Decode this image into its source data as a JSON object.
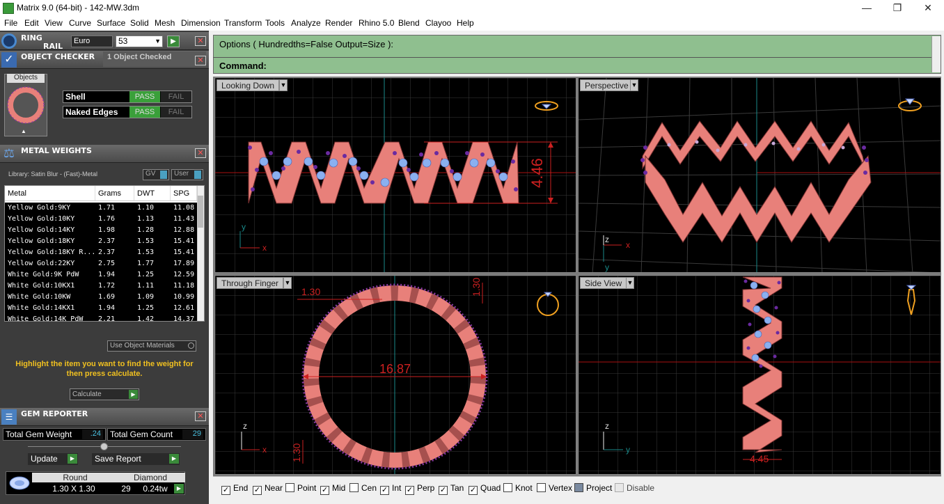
{
  "window": {
    "title": "Matrix 9.0 (64-bit) - 142-MW.3dm",
    "minimize": "—",
    "maximize": "❐",
    "close": "✕"
  },
  "menu": [
    "File",
    "Edit",
    "View",
    "Curve",
    "Surface",
    "Solid",
    "Mesh",
    "Dimension",
    "Transform",
    "Tools",
    "Analyze",
    "Render",
    "Rhino 5.0",
    "Blend",
    "Clayoo",
    "Help"
  ],
  "ring_rail": {
    "title_line1": "RING",
    "title_line2": "RAIL",
    "size_system": "Euro",
    "size": "53",
    "go": "▶"
  },
  "object_checker": {
    "title": "OBJECT CHECKER",
    "status": "1  Object Checked",
    "objects_label": "Objects",
    "checks": [
      {
        "name": "Shell",
        "pass": "PASS",
        "fail": "FAIL"
      },
      {
        "name": "Naked Edges",
        "pass": "PASS",
        "fail": "FAIL"
      }
    ]
  },
  "metal_weights": {
    "title": "METAL WEIGHTS",
    "library": "Library: Satin Blur - (Fast)-Metal",
    "gv_label": "GV",
    "user_label": "User",
    "columns": [
      "Metal",
      "Grams",
      "DWT",
      "SPG"
    ],
    "rows": [
      [
        "Yellow Gold:9KY",
        "1.71",
        "1.10",
        "11.08"
      ],
      [
        "Yellow Gold:10KY",
        "1.76",
        "1.13",
        "11.43"
      ],
      [
        "Yellow Gold:14KY",
        "1.98",
        "1.28",
        "12.88"
      ],
      [
        "Yellow Gold:18KY",
        "2.37",
        "1.53",
        "15.41"
      ],
      [
        "Yellow Gold:18KY R...",
        "2.37",
        "1.53",
        "15.41"
      ],
      [
        "Yellow Gold:22KY",
        "2.75",
        "1.77",
        "17.89"
      ],
      [
        "White Gold:9K PdW",
        "1.94",
        "1.25",
        "12.59"
      ],
      [
        "White Gold:10KX1",
        "1.72",
        "1.11",
        "11.18"
      ],
      [
        "White Gold:10KW",
        "1.69",
        "1.09",
        "10.99"
      ],
      [
        "White Gold:14KX1",
        "1.94",
        "1.25",
        "12.61"
      ],
      [
        "White Gold:14K PdW",
        "2.21",
        "1.42",
        "14.37"
      ]
    ],
    "use_object_materials": "Use Object Materials",
    "hint": "Highlight the item you want to find the weight for then press calculate.",
    "calculate": "Calculate",
    "go": "▶"
  },
  "gem_reporter": {
    "title": "GEM REPORTER",
    "total_weight_label": "Total Gem Weight",
    "total_weight": ".24",
    "total_count_label": "Total Gem Count",
    "total_count": "29",
    "update": "Update",
    "save_report": "Save Report",
    "gem": {
      "shape": "Round",
      "type": "Diamond",
      "size": "1.30 X 1.30",
      "count": "29",
      "weight": "0.24tw"
    }
  },
  "command": {
    "options": "Options ( Hundredths=False  Output=Size ):",
    "prompt": "Command:"
  },
  "viewports": {
    "top_left": {
      "label": "Looking Down",
      "dim": "4.46",
      "axis_y": "y",
      "axis_x": "x"
    },
    "top_right": {
      "label": "Perspective",
      "axis_z": "z",
      "axis_y": "y",
      "axis_x": "x"
    },
    "bottom_left": {
      "label": "Through Finger",
      "dim_diameter": "16.87",
      "dim_a": "1.30",
      "dim_b": "1.30",
      "dim_c": "1.30",
      "axis_z": "z",
      "axis_x": "x"
    },
    "bottom_right": {
      "label": "Side View",
      "dim": "4.45",
      "axis_z": "z",
      "axis_y": "y"
    }
  },
  "osnaps": [
    {
      "label": "End",
      "checked": true
    },
    {
      "label": "Near",
      "checked": true
    },
    {
      "label": "Point",
      "checked": false
    },
    {
      "label": "Mid",
      "checked": true
    },
    {
      "label": "Cen",
      "checked": false
    },
    {
      "label": "Int",
      "checked": true
    },
    {
      "label": "Perp",
      "checked": true
    },
    {
      "label": "Tan",
      "checked": true
    },
    {
      "label": "Quad",
      "checked": true
    },
    {
      "label": "Knot",
      "checked": false
    },
    {
      "label": "Vertex",
      "checked": false
    },
    {
      "label": "Project",
      "checked": false
    },
    {
      "label": "Disable",
      "checked": false
    }
  ],
  "colors": {
    "ring": "#e8807a",
    "gem_blue": "#8ab0f0",
    "prong_purple": "#6a2aa0",
    "pass_green": "#3aa03a",
    "command_green": "#8fbf8f",
    "dim_red": "#cc2020",
    "hint_yellow": "#f0c020"
  }
}
